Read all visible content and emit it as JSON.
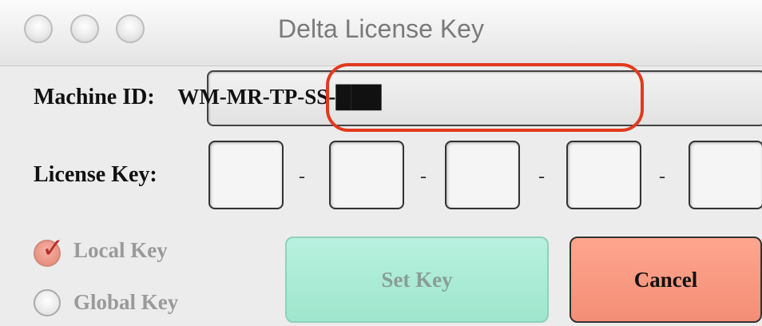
{
  "window": {
    "title": "Delta License Key"
  },
  "machine_id": {
    "label": "Machine ID:",
    "value": "WM-MR-TP-SS-███"
  },
  "license_key": {
    "label": "License Key:",
    "segments": [
      "",
      "",
      "",
      "",
      ""
    ],
    "separator": "-"
  },
  "options": {
    "local_key": {
      "label": "Local Key",
      "checked": true
    },
    "global_key": {
      "label": "Global Key",
      "checked": false
    }
  },
  "buttons": {
    "set_key": "Set Key",
    "cancel": "Cancel"
  },
  "colors": {
    "highlight": "#e23a1e",
    "set_key_bg": "#aeeed9",
    "cancel_bg": "#f89a82"
  }
}
